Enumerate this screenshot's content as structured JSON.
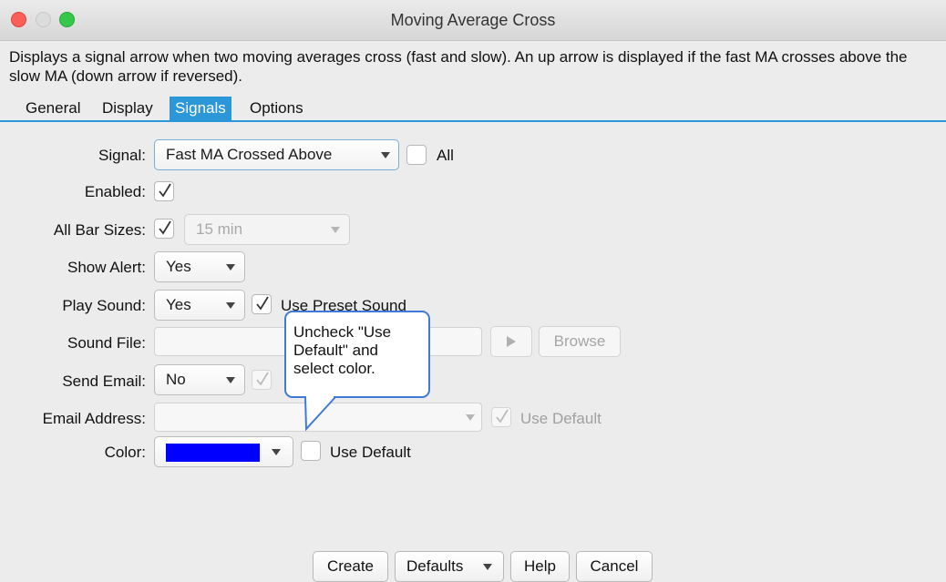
{
  "window": {
    "title": "Moving Average Cross"
  },
  "description": "Displays a signal arrow when two moving averages cross (fast and slow).  An up arrow is displayed if the fast MA crosses above the slow MA (down arrow if reversed).",
  "tabs": [
    {
      "label": "General",
      "active": false
    },
    {
      "label": "Display",
      "active": false
    },
    {
      "label": "Signals",
      "active": true
    },
    {
      "label": "Options",
      "active": false
    }
  ],
  "form": {
    "signal": {
      "label": "Signal:",
      "value": "Fast MA Crossed Above",
      "all_label": "All",
      "all_checked": false
    },
    "enabled": {
      "label": "Enabled:",
      "checked": true
    },
    "all_bar_sizes": {
      "label": "All Bar Sizes:",
      "checked": true,
      "value": "15 min"
    },
    "show_alert": {
      "label": "Show Alert:",
      "value": "Yes"
    },
    "play_sound": {
      "label": "Play Sound:",
      "value": "Yes",
      "use_preset_label": "Use Preset Sound",
      "use_preset_checked": true
    },
    "sound_file": {
      "label": "Sound File:",
      "value": "",
      "browse_label": "Browse"
    },
    "send_email": {
      "label": "Send Email:",
      "value": "No",
      "checked": true
    },
    "email_address": {
      "label": "Email Address:",
      "value": "",
      "use_default_label": "Use Default",
      "use_default_checked": true
    },
    "color": {
      "label": "Color:",
      "value": "#0000ff",
      "use_default_label": "Use Default",
      "use_default_checked": false
    }
  },
  "callout": {
    "text": "Uncheck \"Use Default\" and select color."
  },
  "buttons": {
    "create": "Create",
    "defaults": "Defaults",
    "help": "Help",
    "cancel": "Cancel"
  },
  "colors": {
    "accent": "#2b97d9",
    "callout_border": "#3f7bd6",
    "swatch": "#0000ff"
  },
  "icons": [
    "close-icon",
    "minimize-icon",
    "maximize-icon",
    "chevron-down-icon",
    "checkmark-icon",
    "play-icon"
  ]
}
